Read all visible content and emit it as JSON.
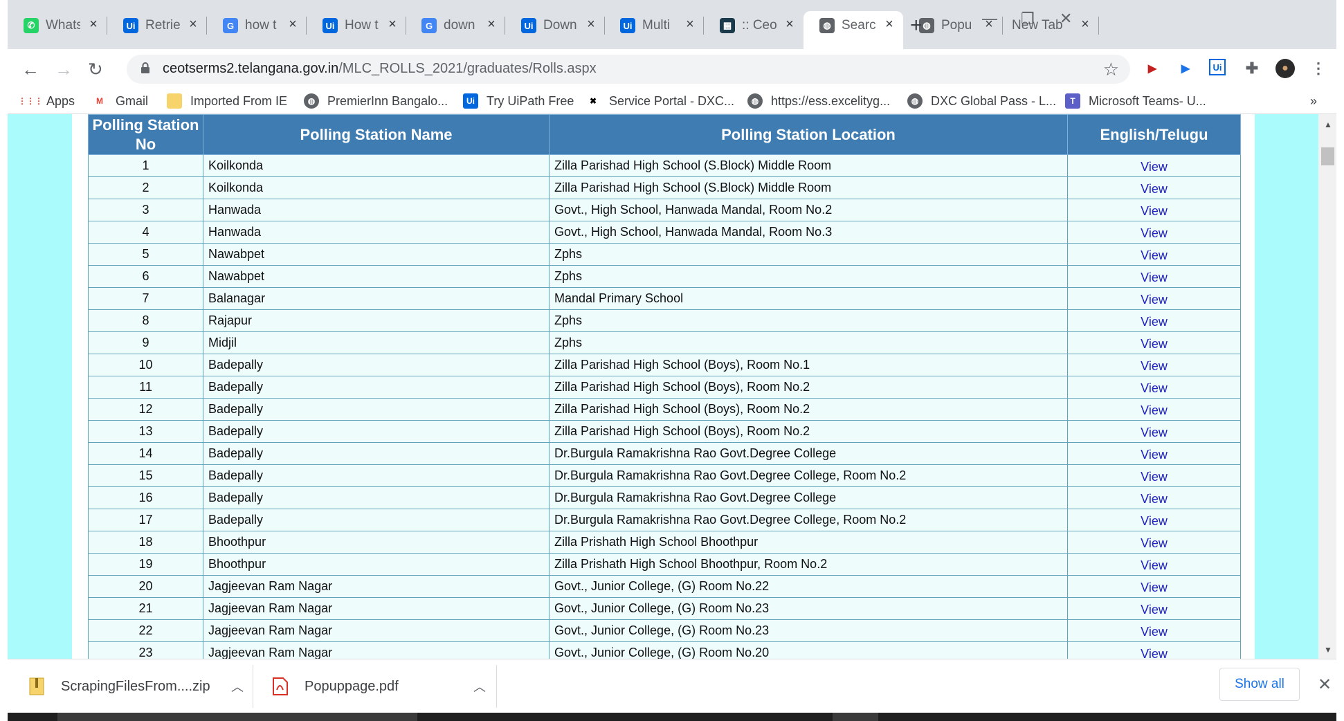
{
  "browser": {
    "tabs": [
      {
        "title": "Whats",
        "icon": "whatsapp-icon",
        "color": "#25d366",
        "glyph": "✆"
      },
      {
        "title": "Retrie",
        "icon": "uipath-icon",
        "color": "#0067df",
        "glyph": "Ui"
      },
      {
        "title": "how t",
        "icon": "google-icon",
        "color": "#4285f4",
        "glyph": "G"
      },
      {
        "title": "How t",
        "icon": "uipath-icon",
        "color": "#0067df",
        "glyph": "Ui"
      },
      {
        "title": "down",
        "icon": "google-icon",
        "color": "#4285f4",
        "glyph": "G"
      },
      {
        "title": "Down",
        "icon": "uipath-icon",
        "color": "#0067df",
        "glyph": "Ui"
      },
      {
        "title": "Multi",
        "icon": "uipath-icon",
        "color": "#0067df",
        "glyph": "Ui"
      },
      {
        "title": ":: Ceo",
        "icon": "ceo-site-icon",
        "color": "#1b3a4b",
        "glyph": "▦"
      },
      {
        "title": "Searc",
        "icon": "globe-icon",
        "color": "#5f6368",
        "glyph": "◍"
      },
      {
        "title": "Popu",
        "icon": "globe-icon",
        "color": "#5f6368",
        "glyph": "◍"
      },
      {
        "title": "New Tab",
        "icon": "",
        "color": "",
        "glyph": ""
      }
    ],
    "url_host": "ceotserms2.telangana.gov.in",
    "url_path": "/MLC_ROLLS_2021/graduates/Rolls.aspx",
    "bookmarks": [
      {
        "label": "Apps",
        "icon": "apps-grid-icon"
      },
      {
        "label": "Gmail",
        "icon": "gmail-icon"
      },
      {
        "label": "Imported From IE",
        "icon": "folder-icon"
      },
      {
        "label": "PremierInn Bangalo...",
        "icon": "globe-icon"
      },
      {
        "label": "Try UiPath Free",
        "icon": "uipath-icon"
      },
      {
        "label": "Service Portal - DXC...",
        "icon": "dxc-icon"
      },
      {
        "label": "https://ess.excelityg...",
        "icon": "globe-icon"
      },
      {
        "label": "DXC Global Pass - L...",
        "icon": "globe-icon"
      },
      {
        "label": "Microsoft Teams- U...",
        "icon": "teams-icon"
      }
    ],
    "more_bookmarks": "»"
  },
  "table": {
    "headers": [
      "Polling Station No",
      "Polling Station Name",
      "Polling Station Location",
      "English/Telugu"
    ],
    "link_label": "View",
    "rows": [
      {
        "no": "1",
        "name": "Koilkonda",
        "location": "Zilla Parishad High School (S.Block) Middle Room"
      },
      {
        "no": "2",
        "name": "Koilkonda",
        "location": "Zilla Parishad High School (S.Block) Middle Room"
      },
      {
        "no": "3",
        "name": "Hanwada",
        "location": "Govt., High School, Hanwada Mandal, Room No.2"
      },
      {
        "no": "4",
        "name": "Hanwada",
        "location": "Govt., High School, Hanwada Mandal, Room No.3"
      },
      {
        "no": "5",
        "name": "Nawabpet",
        "location": "Zphs"
      },
      {
        "no": "6",
        "name": "Nawabpet",
        "location": "Zphs"
      },
      {
        "no": "7",
        "name": "Balanagar",
        "location": "Mandal Primary School"
      },
      {
        "no": "8",
        "name": "Rajapur",
        "location": "Zphs"
      },
      {
        "no": "9",
        "name": "Midjil",
        "location": "Zphs"
      },
      {
        "no": "10",
        "name": "Badepally",
        "location": "Zilla Parishad High School (Boys), Room No.1"
      },
      {
        "no": "11",
        "name": "Badepally",
        "location": "Zilla Parishad High School (Boys), Room No.2"
      },
      {
        "no": "12",
        "name": "Badepally",
        "location": "Zilla Parishad High School (Boys), Room No.2"
      },
      {
        "no": "13",
        "name": "Badepally",
        "location": "Zilla Parishad High School (Boys), Room No.2"
      },
      {
        "no": "14",
        "name": "Badepally",
        "location": "Dr.Burgula Ramakrishna Rao Govt.Degree College"
      },
      {
        "no": "15",
        "name": "Badepally",
        "location": "Dr.Burgula Ramakrishna Rao Govt.Degree College, Room No.2"
      },
      {
        "no": "16",
        "name": "Badepally",
        "location": "Dr.Burgula Ramakrishna Rao Govt.Degree College"
      },
      {
        "no": "17",
        "name": "Badepally",
        "location": "Dr.Burgula Ramakrishna Rao Govt.Degree College, Room No.2"
      },
      {
        "no": "18",
        "name": "Bhoothpur",
        "location": "Zilla Prishath High School Bhoothpur"
      },
      {
        "no": "19",
        "name": "Bhoothpur",
        "location": "Zilla Prishath High School Bhoothpur, Room No.2"
      },
      {
        "no": "20",
        "name": "Jagjeevan Ram Nagar",
        "location": "Govt., Junior College, (G) Room No.22"
      },
      {
        "no": "21",
        "name": "Jagjeevan Ram Nagar",
        "location": "Govt., Junior College, (G) Room No.23"
      },
      {
        "no": "22",
        "name": "Jagjeevan Ram Nagar",
        "location": "Govt., Junior College, (G) Room No.23"
      },
      {
        "no": "23",
        "name": "Jagjeevan Ram Nagar",
        "location": "Govt., Junior College, (G) Room No.20"
      }
    ]
  },
  "downloads": {
    "items": [
      {
        "filename": "ScrapingFilesFrom....zip",
        "icon": "zip-file-icon"
      },
      {
        "filename": "Popuppage.pdf",
        "icon": "pdf-file-icon"
      }
    ],
    "show_all": "Show all"
  },
  "colors": {
    "header_bg": "#3e7cb1",
    "cell_bg": "#eefcfc",
    "page_bg": "#aafcfc",
    "link": "#1f1fc8"
  }
}
